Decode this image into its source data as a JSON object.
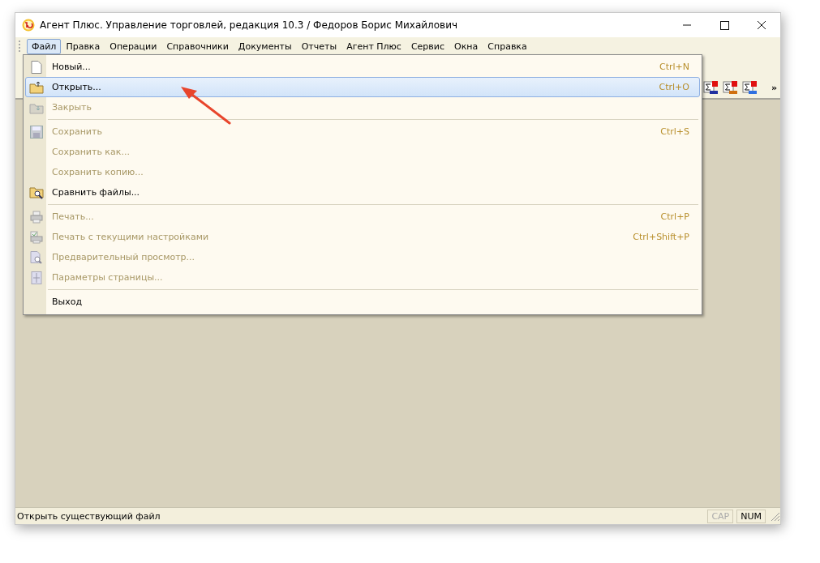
{
  "window": {
    "title": "Агент Плюс. Управление торговлей, редакция 10.3 / Федоров Борис Михайлович"
  },
  "menubar": [
    {
      "label": "Файл",
      "selected": true
    },
    {
      "label": "Правка",
      "selected": false
    },
    {
      "label": "Операции",
      "selected": false
    },
    {
      "label": "Справочники",
      "selected": false
    },
    {
      "label": "Документы",
      "selected": false
    },
    {
      "label": "Отчеты",
      "selected": false
    },
    {
      "label": "Агент Плюс",
      "selected": false
    },
    {
      "label": "Сервис",
      "selected": false
    },
    {
      "label": "Окна",
      "selected": false
    },
    {
      "label": "Справка",
      "selected": false
    }
  ],
  "toolbar": {
    "more": "»"
  },
  "file_menu": [
    {
      "kind": "item",
      "label": "Новый...",
      "shortcut": "Ctrl+N",
      "disabled": false,
      "selected": false
    },
    {
      "kind": "item",
      "label": "Открыть...",
      "shortcut": "Ctrl+O",
      "disabled": false,
      "selected": true
    },
    {
      "kind": "item",
      "label": "Закрыть",
      "disabled": true,
      "selected": false
    },
    {
      "kind": "separator"
    },
    {
      "kind": "item",
      "label": "Сохранить",
      "shortcut": "Ctrl+S",
      "disabled": true,
      "selected": false
    },
    {
      "kind": "item",
      "label": "Сохранить как...",
      "disabled": true,
      "selected": false
    },
    {
      "kind": "item",
      "label": "Сохранить копию...",
      "disabled": true,
      "selected": false
    },
    {
      "kind": "item",
      "label": "Сравнить файлы...",
      "disabled": false,
      "selected": false
    },
    {
      "kind": "separator"
    },
    {
      "kind": "item",
      "label": "Печать...",
      "shortcut": "Ctrl+P",
      "disabled": true,
      "selected": false
    },
    {
      "kind": "item",
      "label": "Печать с текущими настройками",
      "shortcut": "Ctrl+Shift+P",
      "disabled": true,
      "selected": false
    },
    {
      "kind": "item",
      "label": "Предварительный просмотр...",
      "disabled": true,
      "selected": false
    },
    {
      "kind": "item",
      "label": "Параметры страницы...",
      "disabled": true,
      "selected": false
    },
    {
      "kind": "separator"
    },
    {
      "kind": "item",
      "label": "Выход",
      "disabled": false,
      "selected": false
    }
  ],
  "status_bar": {
    "text": "Открыть существующий файл",
    "indicators": [
      {
        "label": "CAP",
        "on": false
      },
      {
        "label": "NUM",
        "on": true
      }
    ]
  }
}
